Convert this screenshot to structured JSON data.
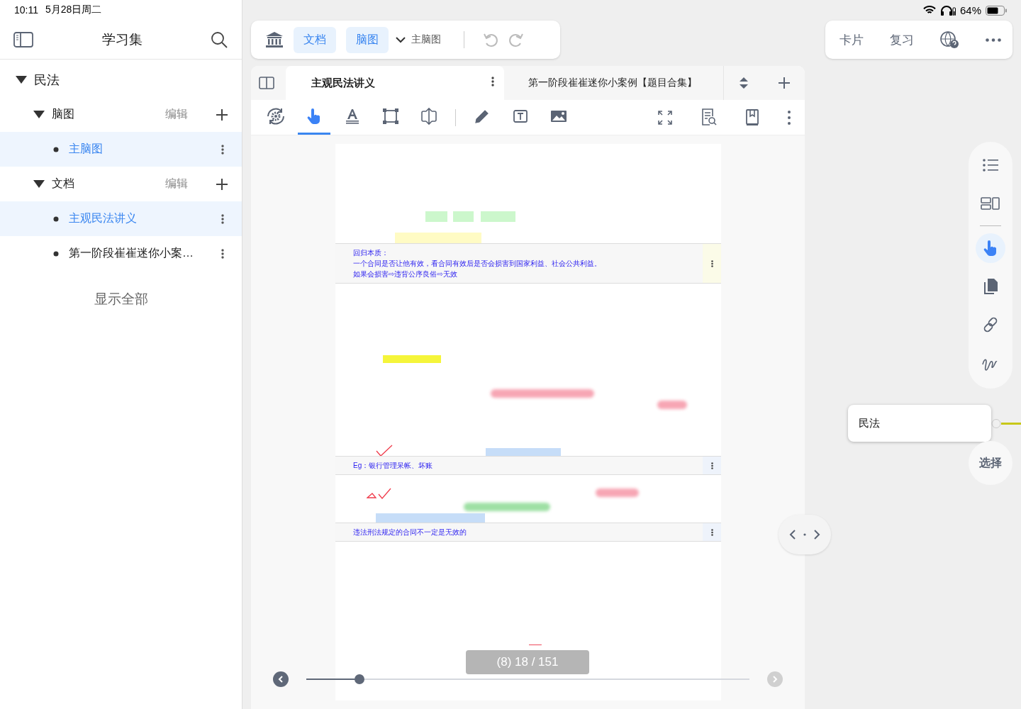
{
  "status_bar": {
    "time": "10:11",
    "date": "5月28日周二",
    "battery": "64%"
  },
  "sidebar": {
    "title": "学习集",
    "tree": [
      {
        "label": "民法",
        "expanded": true,
        "children": [
          {
            "label": "脑图",
            "expanded": true,
            "action": "编辑",
            "children": [
              {
                "label": "主脑图",
                "selected": true
              }
            ]
          },
          {
            "label": "文档",
            "expanded": true,
            "action": "编辑",
            "children": [
              {
                "label": "主观民法讲义",
                "selected": true
              },
              {
                "label": "第一阶段崔崔迷你小案…",
                "selected": false
              }
            ]
          }
        ]
      }
    ],
    "show_all": "显示全部"
  },
  "top_toolbar": {
    "toggles": [
      {
        "label": "文档",
        "on": true
      },
      {
        "label": "脑图",
        "on": true
      }
    ],
    "dropdown": "主脑图"
  },
  "document": {
    "tabs": [
      {
        "label": "主观民法讲义",
        "selected": true
      },
      {
        "label": "第一阶段崔崔迷你小案例【题目合集】",
        "selected": false
      }
    ],
    "tools": [
      {
        "kind": "rotate",
        "selected": false
      },
      {
        "kind": "hand",
        "selected": true
      },
      {
        "kind": "text",
        "selected": false
      },
      {
        "kind": "frame",
        "selected": false
      },
      {
        "kind": "resize",
        "selected": false
      },
      {
        "kind": "pencil",
        "selected": false
      },
      {
        "kind": "textbox",
        "selected": false
      },
      {
        "kind": "image",
        "selected": false
      }
    ],
    "notes": [
      {
        "lines": [
          "回归本质：",
          "一个合同是否让他有效，看合同有效后是否会损害到国家利益、社会公共利益。",
          "如果会损害⇨违背公序良俗⇨无效"
        ]
      },
      {
        "lines": [
          "Eg：银行管理呆帐、坏账"
        ]
      },
      {
        "lines": [
          "违法刑法规定的合同不一定是无效的"
        ]
      }
    ],
    "page_indicator": "(8) 18 / 151",
    "slider": {
      "level": 0.12
    }
  },
  "right_bar": {
    "buttons": [
      "卡片",
      "复习"
    ]
  },
  "rail": [
    {
      "kind": "list",
      "selected": false
    },
    {
      "kind": "layout",
      "selected": false
    },
    {
      "kind": "hand",
      "selected": true
    },
    {
      "kind": "copy",
      "selected": false
    },
    {
      "kind": "link",
      "selected": false
    },
    {
      "kind": "scribble",
      "selected": false
    }
  ],
  "mindmap": {
    "node": "民法"
  },
  "select_button": "选择"
}
